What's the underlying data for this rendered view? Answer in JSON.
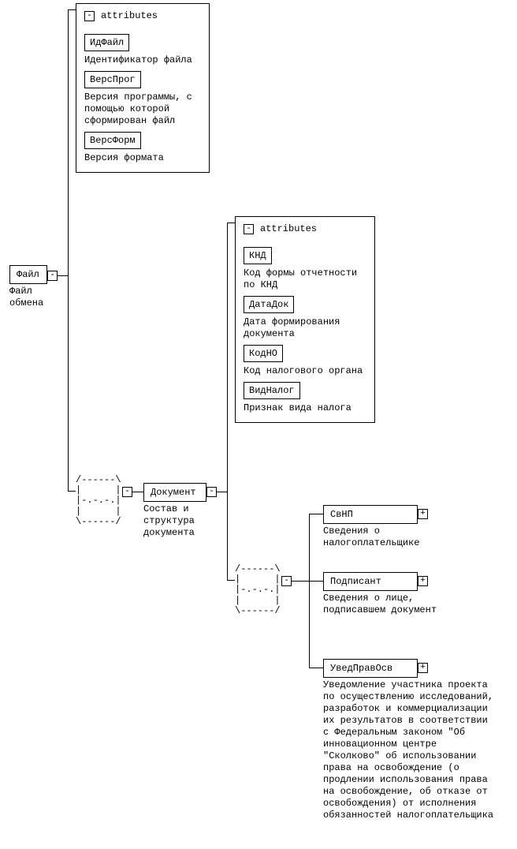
{
  "root": {
    "name": "Файл",
    "desc": "Файл обмена"
  },
  "attr_panel_1": {
    "title": "attributes",
    "items": [
      {
        "name": "ИдФайл",
        "desc": "Идентификатор файла"
      },
      {
        "name": "ВерсПрог",
        "desc": "Версия программы, с помощью которой сформирован файл"
      },
      {
        "name": "ВерсФорм",
        "desc": "Версия формата"
      }
    ]
  },
  "doc_node": {
    "name": "Документ",
    "desc": "Состав и структура документа"
  },
  "attr_panel_2": {
    "title": "attributes",
    "items": [
      {
        "name": "КНД",
        "desc": "Код формы отчетности по КНД"
      },
      {
        "name": "ДатаДок",
        "desc": "Дата формирования документа"
      },
      {
        "name": "КодНО",
        "desc": "Код налогового органа"
      },
      {
        "name": "ВидНалог",
        "desc": "Признак вида налога"
      }
    ]
  },
  "children": {
    "svnp": {
      "name": "СвНП",
      "desc": "Сведения о налогоплательщике"
    },
    "podpisant": {
      "name": "Подписант",
      "desc": "Сведения о лице, подписавшем документ"
    },
    "uved": {
      "name": "УведПравОсв",
      "desc": "Уведомление участника проекта по осуществлению исследований, разработок и коммерциализации их результатов в соответствии с Федеральным законом \"Об инновационном центре \"Сколково\" об использовании права на освобождение (о продлении использования права на освобождение, об отказе от освобождения) от исполнения обязанностей налогоплательщика"
    }
  },
  "glyphs": {
    "minus": "-",
    "plus": "+"
  }
}
